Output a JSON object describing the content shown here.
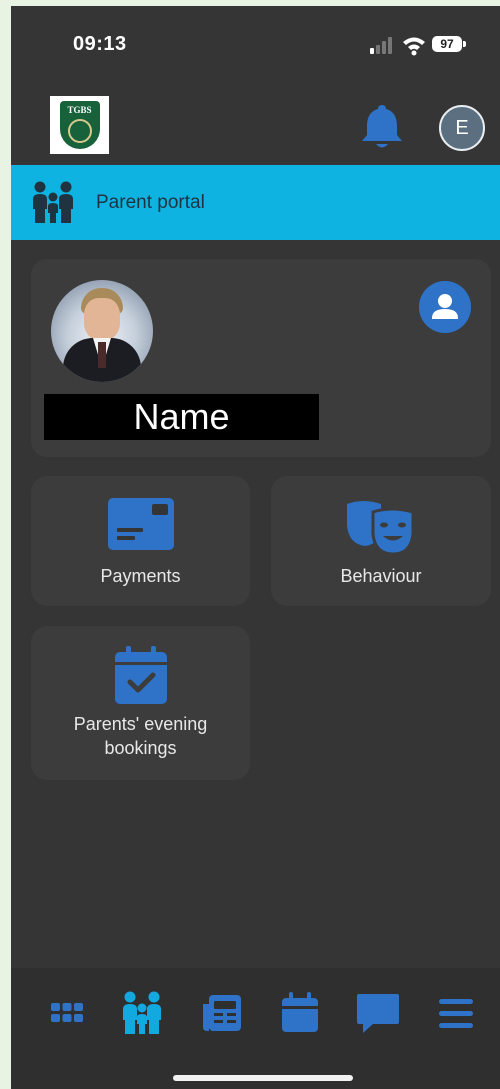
{
  "status_bar": {
    "time": "09:13",
    "battery": "97"
  },
  "header": {
    "logo_text": "TGBS",
    "account_initial": "E"
  },
  "portal": {
    "label": "Parent portal"
  },
  "profile": {
    "name": "Name"
  },
  "tiles": {
    "payments": "Payments",
    "behaviour": "Behaviour",
    "parents_evening": "Parents' evening bookings"
  },
  "colors": {
    "accent": "#2e73c7",
    "portal_bar": "#0eb3e1",
    "background": "#353535",
    "card": "#3c3c3c"
  },
  "icons": {
    "status": [
      "signal-icon",
      "wifi-icon",
      "battery-icon"
    ],
    "header": [
      "school-logo",
      "bell-icon",
      "account-avatar"
    ],
    "tiles": [
      "credit-card-icon",
      "theater-masks-icon",
      "calendar-check-icon"
    ],
    "nav": [
      "grid-icon",
      "family-icon",
      "newspaper-icon",
      "calendar-icon",
      "chat-icon",
      "menu-icon"
    ]
  }
}
